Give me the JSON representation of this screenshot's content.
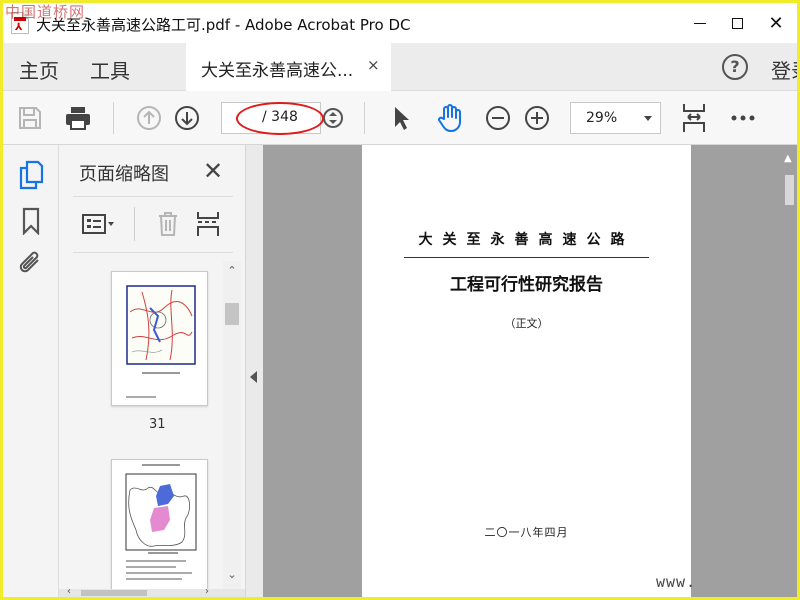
{
  "window": {
    "title": "大关至永善高速公路工可.pdf - Adobe Acrobat Pro DC",
    "watermark_top": "中国道桥网",
    "controls": {
      "minimize": "",
      "maximize": "",
      "close": "✕"
    }
  },
  "tabs": {
    "home": "主页",
    "tools": "工具",
    "document": "大关至永善高速公...",
    "document_close": "×",
    "help": "?",
    "signin": "登录"
  },
  "toolbar": {
    "current_page": "",
    "total_pages": "/ 348",
    "zoom": "29%",
    "icons": [
      "save-icon",
      "print-icon",
      "page-up-icon",
      "page-down-icon",
      "page-stepper-icon",
      "select-arrow-icon",
      "hand-tool-icon",
      "zoom-out-icon",
      "zoom-in-icon",
      "fit-page-icon",
      "more-icon"
    ],
    "annotation_color": "#e21a1a"
  },
  "left_rail": {
    "icons": [
      "page-thumbnails-icon",
      "bookmark-icon",
      "attachment-icon"
    ],
    "active_color": "#1473e6"
  },
  "panel": {
    "title": "页面缩略图",
    "close": "✕",
    "tools": [
      "thumbnail-options-icon",
      "delete-icon",
      "insert-page-icon"
    ],
    "thumbnails": [
      {
        "label": "31"
      },
      {
        "label": ""
      }
    ]
  },
  "page": {
    "title": "大关至永善高速公路",
    "subtitle": "工程可行性研究报告",
    "note": "（正文）",
    "date": "二〇一八年四月"
  },
  "watermark_bottom": "www."
}
